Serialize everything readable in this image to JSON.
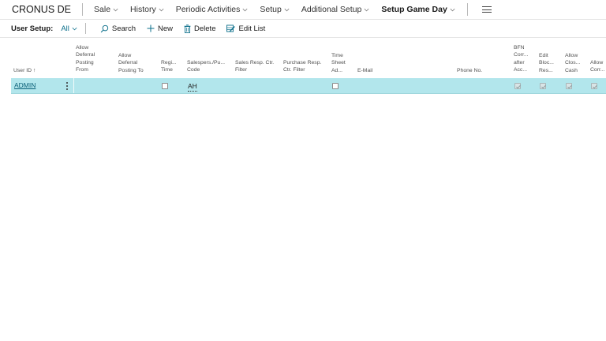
{
  "nav": {
    "company": "CRONUS DE",
    "items": [
      {
        "label": "Sale",
        "chevron": true
      },
      {
        "label": "History",
        "chevron": true
      },
      {
        "label": "Periodic Activities",
        "chevron": true
      },
      {
        "label": "Setup",
        "chevron": true
      },
      {
        "label": "Additional Setup",
        "chevron": true
      },
      {
        "label": "Setup Game Day",
        "chevron": true
      }
    ]
  },
  "actionbar": {
    "title": "User Setup:",
    "filter": "All",
    "search": "Search",
    "new": "New",
    "delete": "Delete",
    "edit_list": "Edit List"
  },
  "table": {
    "headers": {
      "user_id": "User ID ↑",
      "allow_deferral_from": [
        "Allow",
        "Deferral",
        "Posting",
        "From"
      ],
      "allow_deferral_to": [
        "Allow",
        "Deferral",
        "Posting To"
      ],
      "register_time": [
        "Regi...",
        "Time"
      ],
      "salespers": [
        "Salespers./Pu...",
        "Code"
      ],
      "sales_resp": [
        "Sales Resp. Ctr.",
        "Filter"
      ],
      "purchase_resp": [
        "Purchase Resp.",
        "Ctr. Filter"
      ],
      "time_sheet": [
        "Time",
        "Sheet",
        "Ad..."
      ],
      "email": [
        "E-Mail"
      ],
      "phone": [
        "Phone No."
      ],
      "bfn": [
        "BFN",
        "Corr...",
        "after",
        "Acc..."
      ],
      "edit_block": [
        "Edit",
        "Bloc...",
        "Res..."
      ],
      "allow_close": [
        "Allow",
        "Clos...",
        "Cash"
      ],
      "allow_corr": [
        "Allow",
        "Corr..."
      ]
    },
    "rows": [
      {
        "user_id": "ADMIN",
        "salespers": "AH",
        "register_time": false,
        "time_sheet": false,
        "bfn": true,
        "edit_block": true,
        "allow_close": true,
        "allow_corr": true
      }
    ]
  },
  "colors": {
    "accent": "#0a6e8a",
    "selected_row": "#b2e6ec"
  }
}
